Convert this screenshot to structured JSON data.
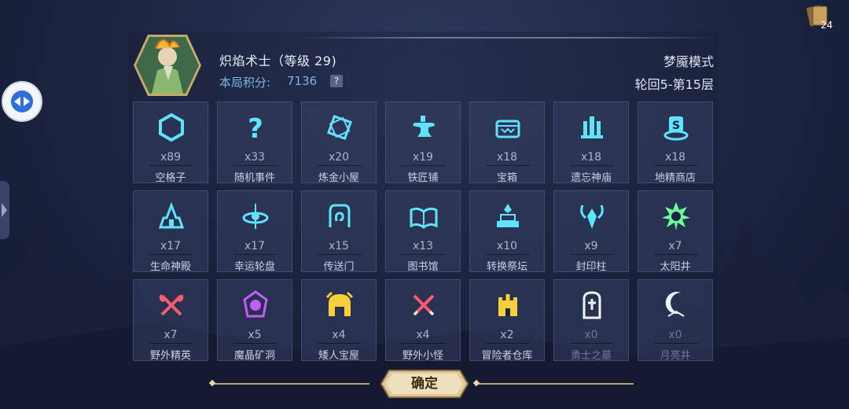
{
  "player": {
    "name": "炽焰术士（等级 29)",
    "score_label": "本局积分:",
    "score_value": "7136",
    "help": "?"
  },
  "mode": "梦魇模式",
  "floor": "轮回5-第15层",
  "cards_count": "24",
  "confirm_label": "确定",
  "colors": {
    "cyan": "#5fe3ff",
    "gold": "#f6cf3a",
    "red": "#ff5b6e",
    "purple": "#c35bff",
    "green": "#6dff9a",
    "white": "#f0f4ff"
  },
  "tiles": [
    {
      "name": "空格子",
      "count": "x89",
      "icon": "hexagon-icon",
      "color": "cyan"
    },
    {
      "name": "随机事件",
      "count": "x33",
      "icon": "question-icon",
      "color": "cyan"
    },
    {
      "name": "炼金小屋",
      "count": "x20",
      "icon": "alchemy-icon",
      "color": "cyan"
    },
    {
      "name": "铁匠铺",
      "count": "x19",
      "icon": "anvil-icon",
      "color": "cyan"
    },
    {
      "name": "宝箱",
      "count": "x18",
      "icon": "chest-icon",
      "color": "cyan"
    },
    {
      "name": "遗忘神庙",
      "count": "x18",
      "icon": "temple-icon",
      "color": "cyan"
    },
    {
      "name": "地精商店",
      "count": "x18",
      "icon": "shop-icon",
      "color": "cyan"
    },
    {
      "name": "生命神殿",
      "count": "x17",
      "icon": "shrine-icon",
      "color": "cyan"
    },
    {
      "name": "幸运轮盘",
      "count": "x17",
      "icon": "wheel-icon",
      "color": "cyan"
    },
    {
      "name": "传送门",
      "count": "x15",
      "icon": "portal-icon",
      "color": "cyan"
    },
    {
      "name": "图书馆",
      "count": "x13",
      "icon": "book-icon",
      "color": "cyan"
    },
    {
      "name": "转换祭坛",
      "count": "x10",
      "icon": "altar-icon",
      "color": "cyan"
    },
    {
      "name": "封印柱",
      "count": "x9",
      "icon": "seal-icon",
      "color": "cyan"
    },
    {
      "name": "太阳井",
      "count": "x7",
      "icon": "sun-icon",
      "color": "green"
    },
    {
      "name": "野外精英",
      "count": "x7",
      "icon": "axes-icon",
      "color": "red"
    },
    {
      "name": "魔晶矿洞",
      "count": "x5",
      "icon": "crystal-icon",
      "color": "purple"
    },
    {
      "name": "矮人宝屋",
      "count": "x4",
      "icon": "helmet-icon",
      "color": "gold"
    },
    {
      "name": "野外小怪",
      "count": "x4",
      "icon": "swords-icon",
      "color": "red"
    },
    {
      "name": "冒险者仓库",
      "count": "x2",
      "icon": "castle-icon",
      "color": "gold"
    },
    {
      "name": "勇士之墓",
      "count": "x0",
      "icon": "tomb-icon",
      "color": "white",
      "dim": true
    },
    {
      "name": "月亮井",
      "count": "x0",
      "icon": "moon-icon",
      "color": "white",
      "dim": true
    }
  ]
}
